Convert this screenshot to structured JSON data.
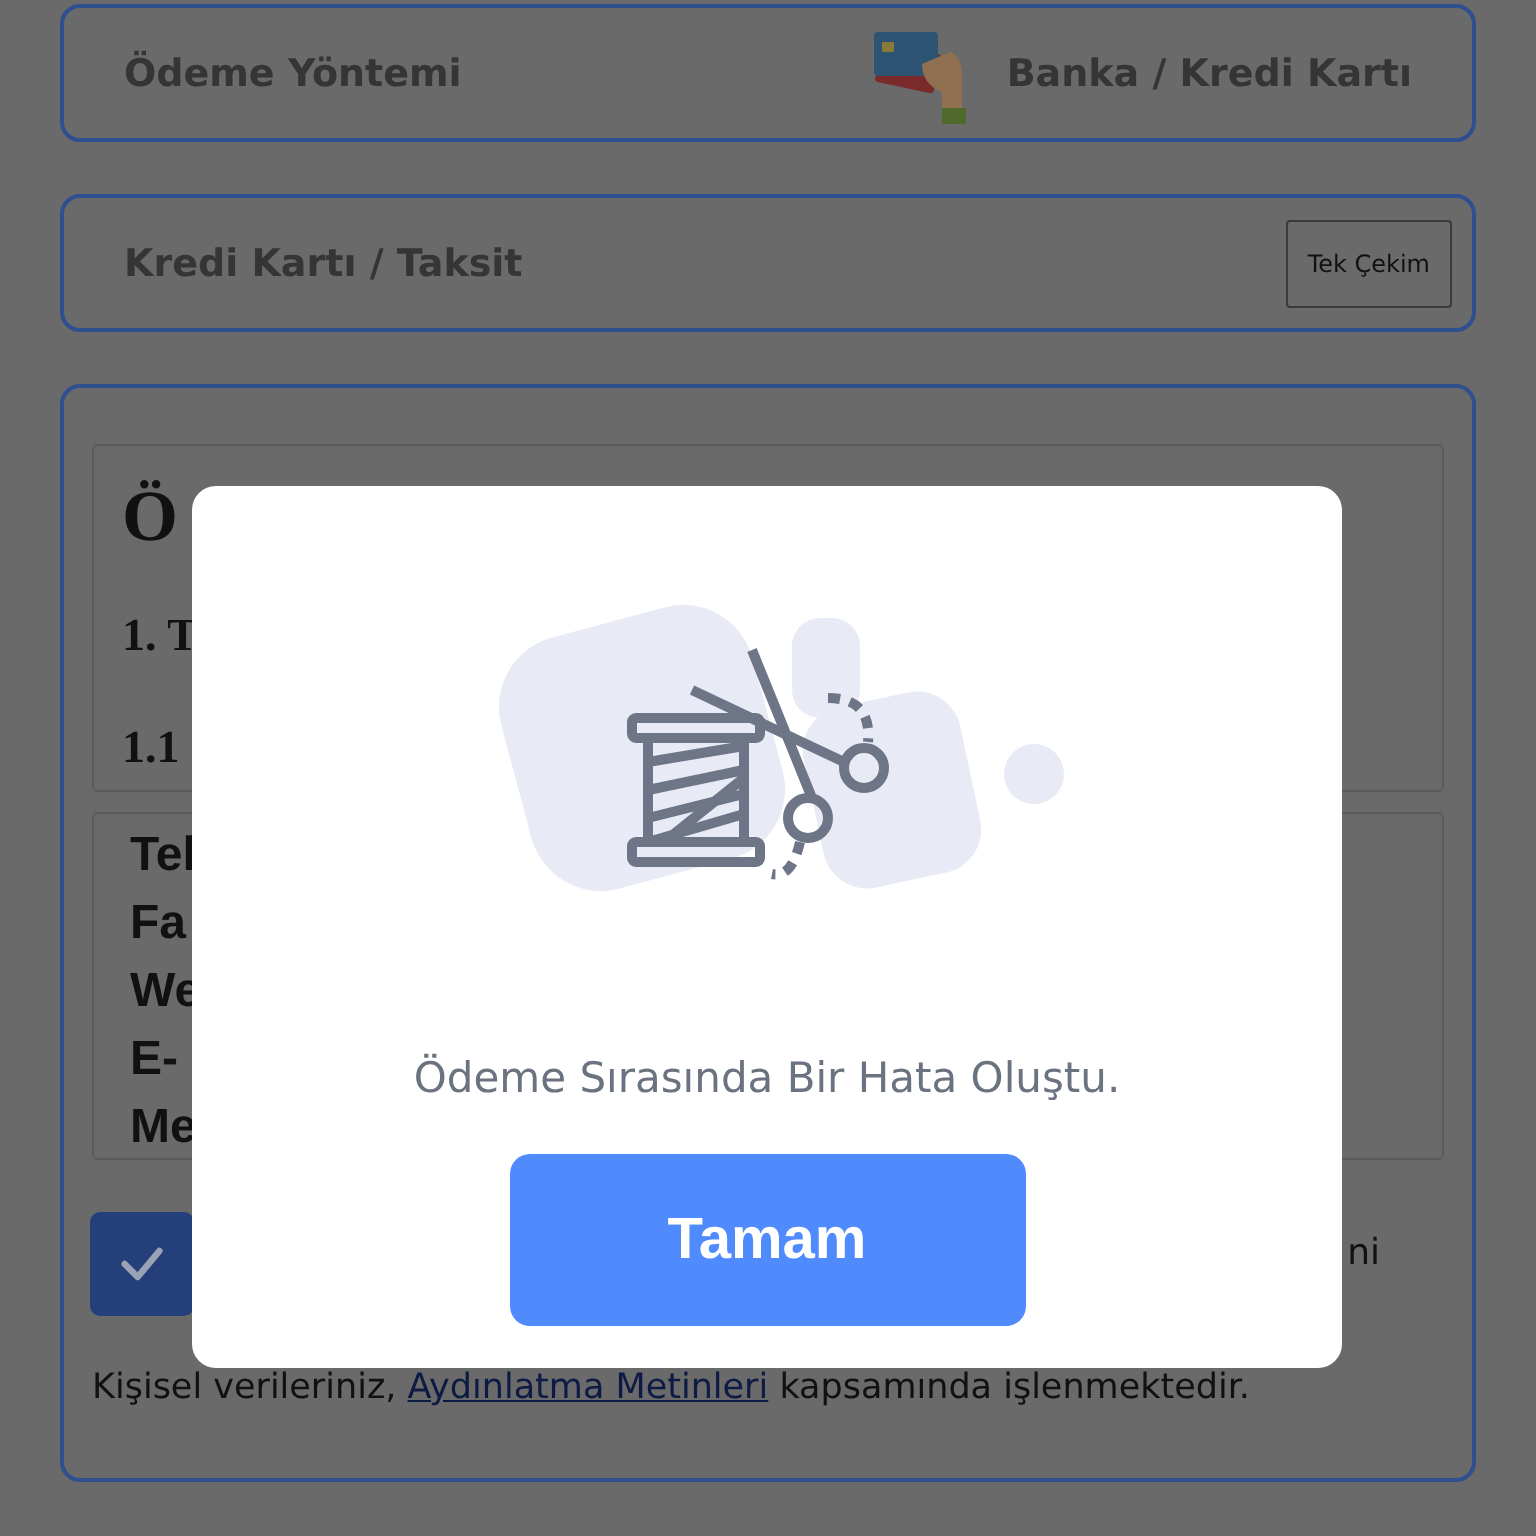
{
  "payment_method": {
    "label": "Ödeme Yöntemi",
    "value": "Banka / Kredi Kartı"
  },
  "installment": {
    "label": "Kredi Kartı / Taksit",
    "button": "Tek Çekim"
  },
  "agreement": {
    "heading": "Ö",
    "section": "1. T",
    "subsection": "1.1",
    "contact_lines": [
      "Tel",
      "Fa",
      "We",
      "E-",
      "Me"
    ],
    "consent": {
      "checked": true,
      "text_tail": "ni"
    },
    "notice": {
      "before": "Kişisel verileriniz, ",
      "link": "Aydınlatma Metinleri",
      "after": " kapsamında işlenmektedir."
    }
  },
  "dialog": {
    "message": "Ödeme Sırasında Bir Hata Oluştu.",
    "button": "Tamam"
  }
}
